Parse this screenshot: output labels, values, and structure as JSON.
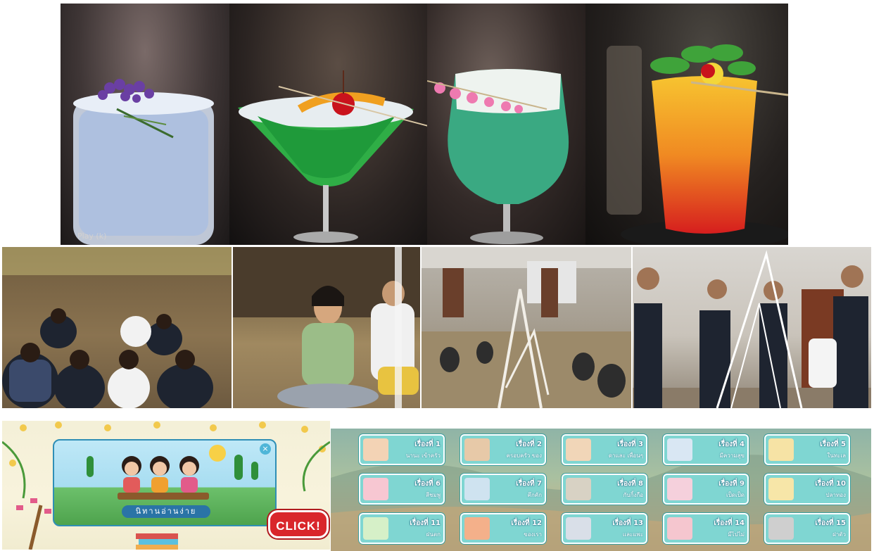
{
  "cocktails": {
    "play_label": "Play (k)"
  },
  "storybook": {
    "close_glyph": "×",
    "title": "นิทานอ่านง่าย",
    "click_label": "CLICK!"
  },
  "story_menu": {
    "items": [
      {
        "number": "เรื่องที่ 1",
        "subtitle": "นานะ เข้าครัว"
      },
      {
        "number": "เรื่องที่ 2",
        "subtitle": "ครอบครัว ของ"
      },
      {
        "number": "เรื่องที่ 3",
        "subtitle": "ดาและ เพื่อนๆ"
      },
      {
        "number": "เรื่องที่ 4",
        "subtitle": "มีความสุข"
      },
      {
        "number": "เรื่องที่ 5",
        "subtitle": "ในทะเล"
      },
      {
        "number": "เรื่องที่ 6",
        "subtitle": "สีชมพู"
      },
      {
        "number": "เรื่องที่ 7",
        "subtitle": "คึกคัก"
      },
      {
        "number": "เรื่องที่ 8",
        "subtitle": "กับกิ้งกือ"
      },
      {
        "number": "เรื่องที่ 9",
        "subtitle": "เป็ดเป็ด"
      },
      {
        "number": "เรื่องที่ 10",
        "subtitle": "ปลาทอง"
      },
      {
        "number": "เรื่องที่ 11",
        "subtitle": "ฝนตก"
      },
      {
        "number": "เรื่องที่ 12",
        "subtitle": "ของเรา"
      },
      {
        "number": "เรื่องที่ 13",
        "subtitle": "และแพะ"
      },
      {
        "number": "เรื่องที่ 14",
        "subtitle": "มีไปไม่"
      },
      {
        "number": "เรื่องที่ 15",
        "subtitle": "ฝาตัว"
      }
    ]
  }
}
